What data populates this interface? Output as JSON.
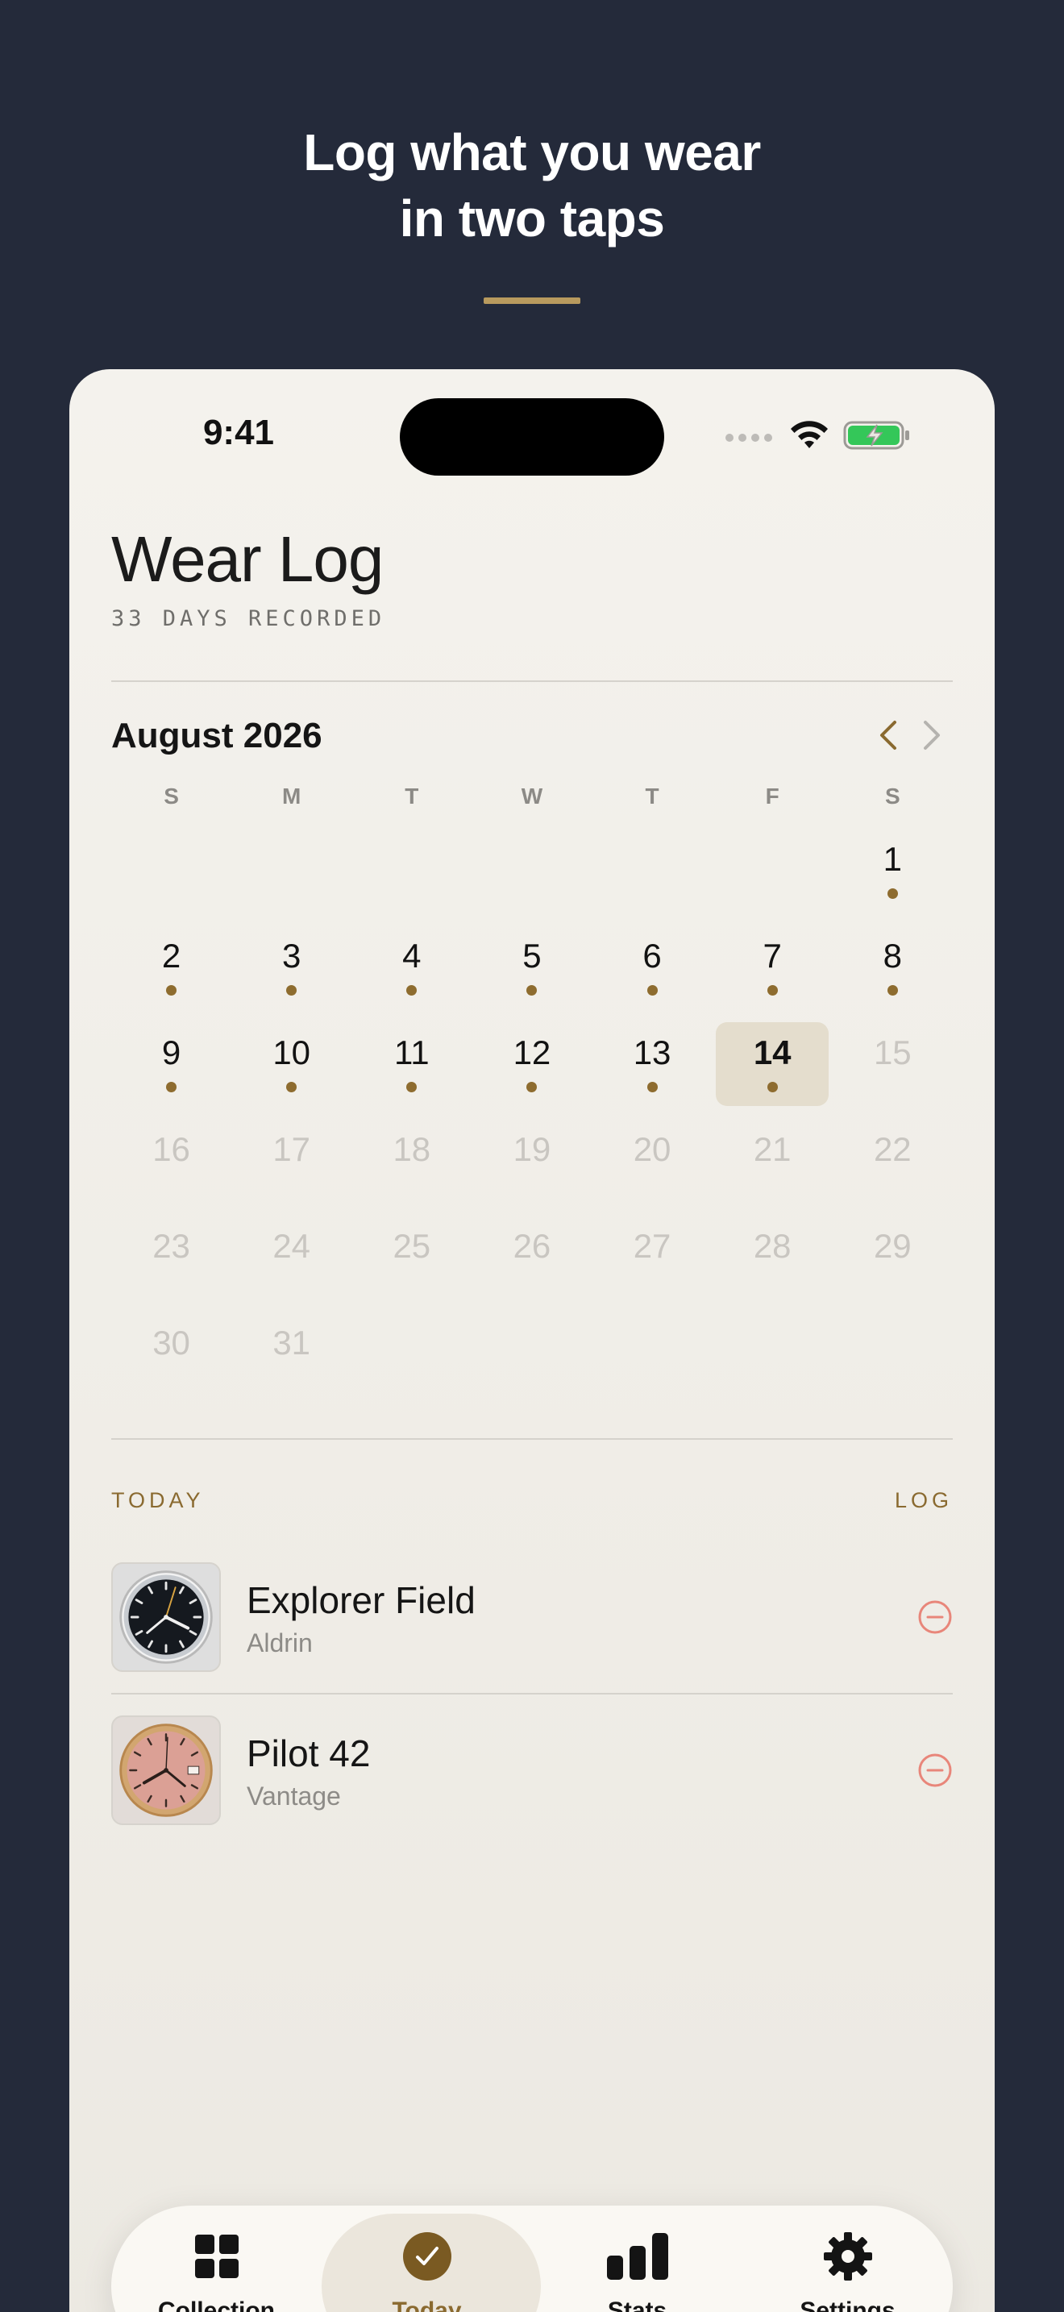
{
  "promo": {
    "headline_line1": "Log what you wear",
    "headline_line2": "in two taps"
  },
  "status_bar": {
    "time": "9:41"
  },
  "header": {
    "title": "Wear Log",
    "subtitle": "33 DAYS RECORDED"
  },
  "calendar": {
    "month_label": "August 2026",
    "weekdays": [
      "S",
      "M",
      "T",
      "W",
      "T",
      "F",
      "S"
    ],
    "days": [
      {
        "n": "",
        "state": "empty"
      },
      {
        "n": "",
        "state": "empty"
      },
      {
        "n": "",
        "state": "empty"
      },
      {
        "n": "",
        "state": "empty"
      },
      {
        "n": "",
        "state": "empty"
      },
      {
        "n": "",
        "state": "empty"
      },
      {
        "n": "1",
        "state": "logged"
      },
      {
        "n": "2",
        "state": "logged"
      },
      {
        "n": "3",
        "state": "logged"
      },
      {
        "n": "4",
        "state": "logged"
      },
      {
        "n": "5",
        "state": "logged"
      },
      {
        "n": "6",
        "state": "logged"
      },
      {
        "n": "7",
        "state": "logged"
      },
      {
        "n": "8",
        "state": "logged"
      },
      {
        "n": "9",
        "state": "logged"
      },
      {
        "n": "10",
        "state": "logged"
      },
      {
        "n": "11",
        "state": "logged"
      },
      {
        "n": "12",
        "state": "logged"
      },
      {
        "n": "13",
        "state": "logged"
      },
      {
        "n": "14",
        "state": "today"
      },
      {
        "n": "15",
        "state": "future"
      },
      {
        "n": "16",
        "state": "future"
      },
      {
        "n": "17",
        "state": "future"
      },
      {
        "n": "18",
        "state": "future"
      },
      {
        "n": "19",
        "state": "future"
      },
      {
        "n": "20",
        "state": "future"
      },
      {
        "n": "21",
        "state": "future"
      },
      {
        "n": "22",
        "state": "future"
      },
      {
        "n": "23",
        "state": "future"
      },
      {
        "n": "24",
        "state": "future"
      },
      {
        "n": "25",
        "state": "future"
      },
      {
        "n": "26",
        "state": "future"
      },
      {
        "n": "27",
        "state": "future"
      },
      {
        "n": "28",
        "state": "future"
      },
      {
        "n": "29",
        "state": "future"
      },
      {
        "n": "30",
        "state": "future"
      },
      {
        "n": "31",
        "state": "future"
      }
    ]
  },
  "today_section": {
    "label": "TODAY",
    "action": "LOG",
    "watches": [
      {
        "name": "Explorer Field",
        "brand": "Aldrin",
        "icon": "watch-dial-icon"
      },
      {
        "name": "Pilot 42",
        "brand": "Vantage",
        "icon": "watch-dial-icon"
      }
    ],
    "remove_icon": "minus-circle-icon"
  },
  "tabs": [
    {
      "label": "Collection",
      "icon": "grid-icon"
    },
    {
      "label": "Today",
      "icon": "check-circle-icon",
      "active": true
    },
    {
      "label": "Stats",
      "icon": "bar-chart-icon"
    },
    {
      "label": "Settings",
      "icon": "gear-icon"
    }
  ],
  "colors": {
    "background": "#242a3a",
    "accent_gold": "#b89a5e",
    "brand_brown": "#8a6a30",
    "remove_red": "#e8867a",
    "battery_green": "#34c759"
  }
}
